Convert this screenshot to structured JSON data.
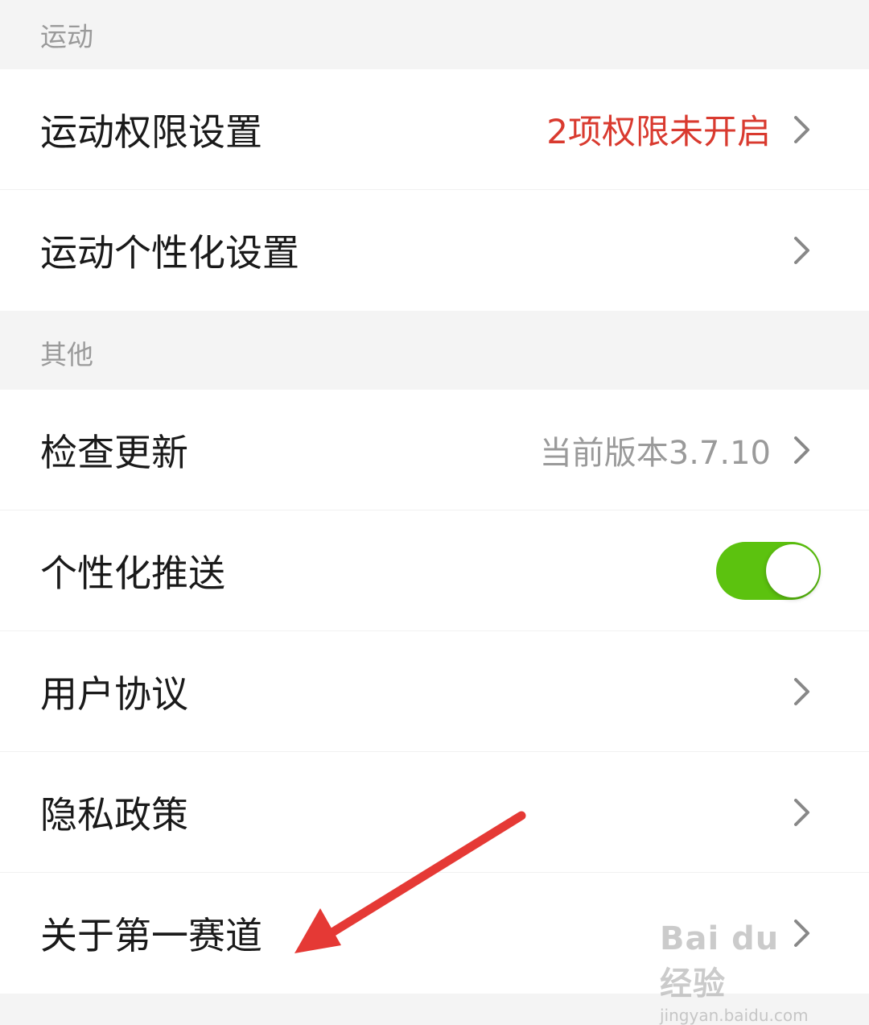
{
  "sections": {
    "sport": {
      "header": "运动",
      "rows": {
        "permission": {
          "title": "运动权限设置",
          "value": "2项权限未开启"
        },
        "personalize": {
          "title": "运动个性化设置"
        }
      }
    },
    "other": {
      "header": "其他",
      "rows": {
        "update": {
          "title": "检查更新",
          "value": "当前版本3.7.10"
        },
        "push": {
          "title": "个性化推送",
          "toggle_on": true
        },
        "agreement": {
          "title": "用户协议"
        },
        "privacy": {
          "title": "隐私政策"
        },
        "about": {
          "title": "关于第一赛道"
        }
      }
    }
  },
  "watermark": {
    "logo_text": "Bai du 经验",
    "url": "jingyan.baidu.com"
  },
  "colors": {
    "warning_red": "#d93a2f",
    "toggle_green": "#5cc20f",
    "arrow_red": "#e53935",
    "background": "#f4f4f4"
  },
  "icons": {
    "chevron": "chevron-right-icon",
    "annotation": "red-arrow-icon"
  }
}
